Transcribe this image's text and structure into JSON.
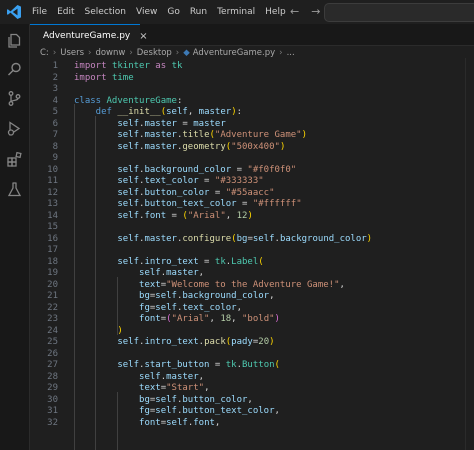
{
  "menu": [
    "File",
    "Edit",
    "Selection",
    "View",
    "Go",
    "Run",
    "Terminal",
    "Help"
  ],
  "nav": {
    "back": "←",
    "forward": "→"
  },
  "tab": {
    "label": "AdventureGame.py",
    "close": "×"
  },
  "breadcrumb": [
    "C:",
    "Users",
    "downw",
    "Desktop",
    "AdventureGame.py",
    "..."
  ],
  "activity_icons": [
    "explorer-icon",
    "search-icon",
    "source-control-icon",
    "run-debug-icon",
    "extensions-icon",
    "testing-icon"
  ],
  "colors": {
    "accent": "#0078d4",
    "editor_bg": "#1f1f1f",
    "keyword": "#c586c0",
    "string": "#ce9178",
    "variable": "#9cdcfe",
    "function": "#dcdcaa",
    "class": "#4ec9b0",
    "number": "#b5cea8"
  },
  "code_lines": [
    [
      {
        "t": "import ",
        "c": "kw"
      },
      {
        "t": "tkinter ",
        "c": "cls"
      },
      {
        "t": "as ",
        "c": "kw"
      },
      {
        "t": "tk",
        "c": "cls"
      }
    ],
    [
      {
        "t": "import ",
        "c": "kw"
      },
      {
        "t": "time",
        "c": "cls"
      }
    ],
    [],
    [
      {
        "t": "class ",
        "c": "def"
      },
      {
        "t": "AdventureGame",
        "c": "cls"
      },
      {
        "t": ":",
        "c": "pl"
      }
    ],
    [
      {
        "t": "    def ",
        "c": "def"
      },
      {
        "t": "__init__",
        "c": "fn"
      },
      {
        "t": "(",
        "c": "br1"
      },
      {
        "t": "self",
        "c": "var"
      },
      {
        "t": ", ",
        "c": "pl"
      },
      {
        "t": "master",
        "c": "var"
      },
      {
        "t": ")",
        "c": "br1"
      },
      {
        "t": ":",
        "c": "pl"
      }
    ],
    [
      {
        "t": "        self",
        "c": "var"
      },
      {
        "t": ".",
        "c": "pl"
      },
      {
        "t": "master",
        "c": "var"
      },
      {
        "t": " = ",
        "c": "pl"
      },
      {
        "t": "master",
        "c": "var"
      }
    ],
    [
      {
        "t": "        self",
        "c": "var"
      },
      {
        "t": ".",
        "c": "pl"
      },
      {
        "t": "master",
        "c": "var"
      },
      {
        "t": ".",
        "c": "pl"
      },
      {
        "t": "title",
        "c": "fn"
      },
      {
        "t": "(",
        "c": "br1"
      },
      {
        "t": "\"Adventure Game\"",
        "c": "str"
      },
      {
        "t": ")",
        "c": "br1"
      }
    ],
    [
      {
        "t": "        self",
        "c": "var"
      },
      {
        "t": ".",
        "c": "pl"
      },
      {
        "t": "master",
        "c": "var"
      },
      {
        "t": ".",
        "c": "pl"
      },
      {
        "t": "geometry",
        "c": "fn"
      },
      {
        "t": "(",
        "c": "br1"
      },
      {
        "t": "\"500x400\"",
        "c": "str"
      },
      {
        "t": ")",
        "c": "br1"
      }
    ],
    [],
    [
      {
        "t": "        self",
        "c": "var"
      },
      {
        "t": ".",
        "c": "pl"
      },
      {
        "t": "background_color",
        "c": "var"
      },
      {
        "t": " = ",
        "c": "pl"
      },
      {
        "t": "\"#f0f0f0\"",
        "c": "str"
      }
    ],
    [
      {
        "t": "        self",
        "c": "var"
      },
      {
        "t": ".",
        "c": "pl"
      },
      {
        "t": "text_color",
        "c": "var"
      },
      {
        "t": " = ",
        "c": "pl"
      },
      {
        "t": "\"#333333\"",
        "c": "str"
      }
    ],
    [
      {
        "t": "        self",
        "c": "var"
      },
      {
        "t": ".",
        "c": "pl"
      },
      {
        "t": "button_color",
        "c": "var"
      },
      {
        "t": " = ",
        "c": "pl"
      },
      {
        "t": "\"#55aacc\"",
        "c": "str"
      }
    ],
    [
      {
        "t": "        self",
        "c": "var"
      },
      {
        "t": ".",
        "c": "pl"
      },
      {
        "t": "button_text_color",
        "c": "var"
      },
      {
        "t": " = ",
        "c": "pl"
      },
      {
        "t": "\"#ffffff\"",
        "c": "str"
      }
    ],
    [
      {
        "t": "        self",
        "c": "var"
      },
      {
        "t": ".",
        "c": "pl"
      },
      {
        "t": "font",
        "c": "var"
      },
      {
        "t": " = ",
        "c": "pl"
      },
      {
        "t": "(",
        "c": "br1"
      },
      {
        "t": "\"Arial\"",
        "c": "str"
      },
      {
        "t": ", ",
        "c": "pl"
      },
      {
        "t": "12",
        "c": "num"
      },
      {
        "t": ")",
        "c": "br1"
      }
    ],
    [],
    [
      {
        "t": "        self",
        "c": "var"
      },
      {
        "t": ".",
        "c": "pl"
      },
      {
        "t": "master",
        "c": "var"
      },
      {
        "t": ".",
        "c": "pl"
      },
      {
        "t": "configure",
        "c": "fn"
      },
      {
        "t": "(",
        "c": "br1"
      },
      {
        "t": "bg",
        "c": "var"
      },
      {
        "t": "=",
        "c": "pl"
      },
      {
        "t": "self",
        "c": "var"
      },
      {
        "t": ".",
        "c": "pl"
      },
      {
        "t": "background_color",
        "c": "var"
      },
      {
        "t": ")",
        "c": "br1"
      }
    ],
    [],
    [
      {
        "t": "        self",
        "c": "var"
      },
      {
        "t": ".",
        "c": "pl"
      },
      {
        "t": "intro_text",
        "c": "var"
      },
      {
        "t": " = ",
        "c": "pl"
      },
      {
        "t": "tk",
        "c": "cls"
      },
      {
        "t": ".",
        "c": "pl"
      },
      {
        "t": "Label",
        "c": "cls"
      },
      {
        "t": "(",
        "c": "br1"
      }
    ],
    [
      {
        "t": "            self",
        "c": "var"
      },
      {
        "t": ".",
        "c": "pl"
      },
      {
        "t": "master",
        "c": "var"
      },
      {
        "t": ",",
        "c": "pl"
      }
    ],
    [
      {
        "t": "            text",
        "c": "var"
      },
      {
        "t": "=",
        "c": "pl"
      },
      {
        "t": "\"Welcome to the Adventure Game!\"",
        "c": "str"
      },
      {
        "t": ",",
        "c": "pl"
      }
    ],
    [
      {
        "t": "            bg",
        "c": "var"
      },
      {
        "t": "=",
        "c": "pl"
      },
      {
        "t": "self",
        "c": "var"
      },
      {
        "t": ".",
        "c": "pl"
      },
      {
        "t": "background_color",
        "c": "var"
      },
      {
        "t": ",",
        "c": "pl"
      }
    ],
    [
      {
        "t": "            fg",
        "c": "var"
      },
      {
        "t": "=",
        "c": "pl"
      },
      {
        "t": "self",
        "c": "var"
      },
      {
        "t": ".",
        "c": "pl"
      },
      {
        "t": "text_color",
        "c": "var"
      },
      {
        "t": ",",
        "c": "pl"
      }
    ],
    [
      {
        "t": "            font",
        "c": "var"
      },
      {
        "t": "=",
        "c": "pl"
      },
      {
        "t": "(",
        "c": "br2"
      },
      {
        "t": "\"Arial\"",
        "c": "str"
      },
      {
        "t": ", ",
        "c": "pl"
      },
      {
        "t": "18",
        "c": "num"
      },
      {
        "t": ", ",
        "c": "pl"
      },
      {
        "t": "\"bold\"",
        "c": "str"
      },
      {
        "t": ")",
        "c": "br2"
      }
    ],
    [
      {
        "t": "        )",
        "c": "br1"
      }
    ],
    [
      {
        "t": "        self",
        "c": "var"
      },
      {
        "t": ".",
        "c": "pl"
      },
      {
        "t": "intro_text",
        "c": "var"
      },
      {
        "t": ".",
        "c": "pl"
      },
      {
        "t": "pack",
        "c": "fn"
      },
      {
        "t": "(",
        "c": "br1"
      },
      {
        "t": "pady",
        "c": "var"
      },
      {
        "t": "=",
        "c": "pl"
      },
      {
        "t": "20",
        "c": "num"
      },
      {
        "t": ")",
        "c": "br1"
      }
    ],
    [],
    [
      {
        "t": "        self",
        "c": "var"
      },
      {
        "t": ".",
        "c": "pl"
      },
      {
        "t": "start_button",
        "c": "var"
      },
      {
        "t": " = ",
        "c": "pl"
      },
      {
        "t": "tk",
        "c": "cls"
      },
      {
        "t": ".",
        "c": "pl"
      },
      {
        "t": "Button",
        "c": "cls"
      },
      {
        "t": "(",
        "c": "br1"
      }
    ],
    [
      {
        "t": "            self",
        "c": "var"
      },
      {
        "t": ".",
        "c": "pl"
      },
      {
        "t": "master",
        "c": "var"
      },
      {
        "t": ",",
        "c": "pl"
      }
    ],
    [
      {
        "t": "            text",
        "c": "var"
      },
      {
        "t": "=",
        "c": "pl"
      },
      {
        "t": "\"Start\"",
        "c": "str"
      },
      {
        "t": ",",
        "c": "pl"
      }
    ],
    [
      {
        "t": "            bg",
        "c": "var"
      },
      {
        "t": "=",
        "c": "pl"
      },
      {
        "t": "self",
        "c": "var"
      },
      {
        "t": ".",
        "c": "pl"
      },
      {
        "t": "button_color",
        "c": "var"
      },
      {
        "t": ",",
        "c": "pl"
      }
    ],
    [
      {
        "t": "            fg",
        "c": "var"
      },
      {
        "t": "=",
        "c": "pl"
      },
      {
        "t": "self",
        "c": "var"
      },
      {
        "t": ".",
        "c": "pl"
      },
      {
        "t": "button_text_color",
        "c": "var"
      },
      {
        "t": ",",
        "c": "pl"
      }
    ],
    [
      {
        "t": "            font",
        "c": "var"
      },
      {
        "t": "=",
        "c": "pl"
      },
      {
        "t": "self",
        "c": "var"
      },
      {
        "t": ".",
        "c": "pl"
      },
      {
        "t": "font",
        "c": "var"
      },
      {
        "t": ",",
        "c": "pl"
      }
    ]
  ]
}
